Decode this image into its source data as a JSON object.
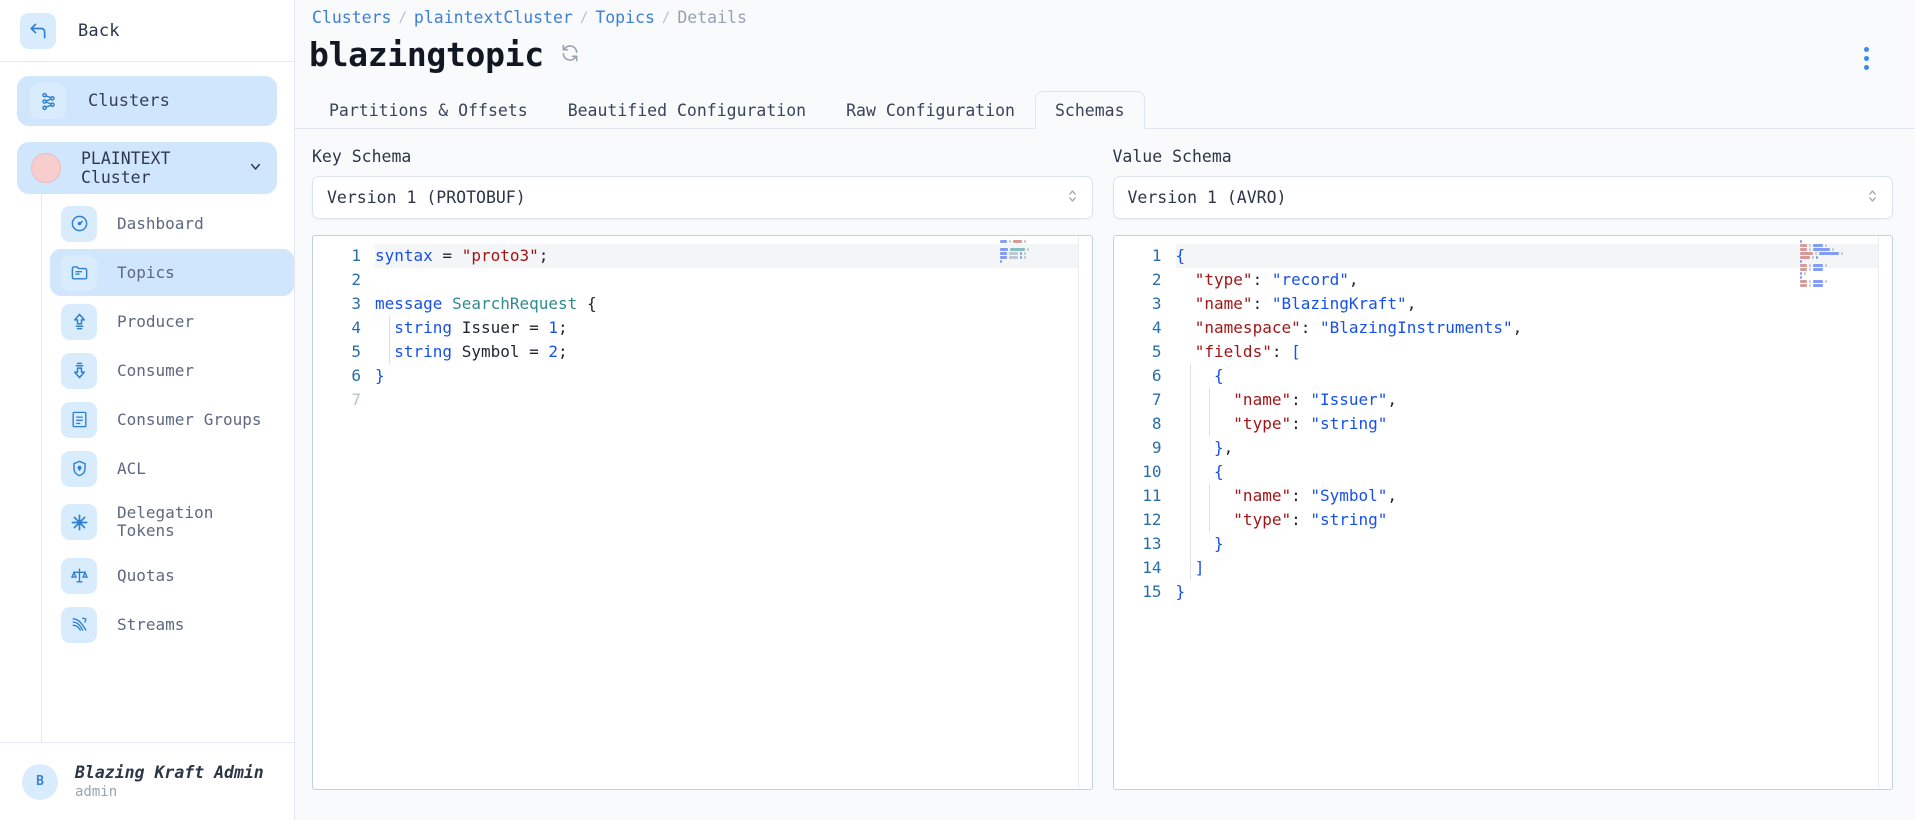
{
  "sidebar": {
    "back": {
      "label": "Back",
      "icon": "back-arrow-icon"
    },
    "clusters": {
      "label": "Clusters",
      "icon": "clusters-icon"
    },
    "cluster": {
      "label": "PLAINTEXT Cluster",
      "chevron": "∨"
    },
    "items": [
      {
        "label": "Dashboard",
        "icon": "gauge-icon",
        "active": false
      },
      {
        "label": "Topics",
        "icon": "folder-icon",
        "active": true
      },
      {
        "label": "Producer",
        "icon": "upload-icon",
        "active": false
      },
      {
        "label": "Consumer",
        "icon": "download-icon",
        "active": false
      },
      {
        "label": "Consumer Groups",
        "icon": "list-box-icon",
        "active": false
      },
      {
        "label": "ACL",
        "icon": "shield-icon",
        "active": false
      },
      {
        "label": "Delegation Tokens",
        "icon": "asterisk-icon",
        "active": false
      },
      {
        "label": "Quotas",
        "icon": "scales-icon",
        "active": false
      },
      {
        "label": "Streams",
        "icon": "streams-icon",
        "active": false
      }
    ],
    "user": {
      "initial": "B",
      "name": "Blazing Kraft Admin",
      "role": "admin"
    }
  },
  "header": {
    "breadcrumb": [
      {
        "label": "Clusters",
        "link": true
      },
      {
        "label": "plaintextCluster",
        "link": true
      },
      {
        "label": "Topics",
        "link": true
      },
      {
        "label": "Details",
        "link": false
      }
    ],
    "separator": "/",
    "title": "blazingtopic",
    "refresh_icon": "refresh-icon",
    "menu_icon": "kebab-menu-icon"
  },
  "tabs": [
    {
      "label": "Partitions & Offsets",
      "selected": false
    },
    {
      "label": "Beautified Configuration",
      "selected": false
    },
    {
      "label": "Raw Configuration",
      "selected": false
    },
    {
      "label": "Schemas",
      "selected": true
    }
  ],
  "key_schema": {
    "label": "Key Schema",
    "version": "Version 1 (PROTOBUF)",
    "line_numbers": [
      "1",
      "2",
      "3",
      "4",
      "5",
      "6",
      "7"
    ],
    "last_line_dim": true,
    "lines": [
      [
        {
          "t": "syntax",
          "c": "k"
        },
        {
          "t": " = ",
          "c": "pn"
        },
        {
          "t": "\"proto3\"",
          "c": "st"
        },
        {
          "t": ";",
          "c": "pn"
        }
      ],
      [],
      [
        {
          "t": "message",
          "c": "k"
        },
        {
          "t": " ",
          "c": "pn"
        },
        {
          "t": "SearchRequest",
          "c": "ty"
        },
        {
          "t": " {",
          "c": "pn"
        }
      ],
      [
        {
          "t": "  ",
          "c": "pn"
        },
        {
          "t": "string",
          "c": "k"
        },
        {
          "t": " Issuer = ",
          "c": "pn"
        },
        {
          "t": "1",
          "c": "nu"
        },
        {
          "t": ";",
          "c": "pn"
        }
      ],
      [
        {
          "t": "  ",
          "c": "pn"
        },
        {
          "t": "string",
          "c": "k"
        },
        {
          "t": " Symbol = ",
          "c": "pn"
        },
        {
          "t": "2",
          "c": "nu"
        },
        {
          "t": ";",
          "c": "pn"
        }
      ],
      [
        {
          "t": "}",
          "c": "k"
        }
      ],
      []
    ]
  },
  "value_schema": {
    "label": "Value Schema",
    "version": "Version 1 (AVRO)",
    "line_numbers": [
      "1",
      "2",
      "3",
      "4",
      "5",
      "6",
      "7",
      "8",
      "9",
      "10",
      "11",
      "12",
      "13",
      "14",
      "15"
    ],
    "last_line_dim": false,
    "lines": [
      [
        {
          "t": "{",
          "c": "br"
        }
      ],
      [
        {
          "t": "  ",
          "c": "pn"
        },
        {
          "t": "\"type\"",
          "c": "jk"
        },
        {
          "t": ": ",
          "c": "pn"
        },
        {
          "t": "\"record\"",
          "c": "jv"
        },
        {
          "t": ",",
          "c": "pn"
        }
      ],
      [
        {
          "t": "  ",
          "c": "pn"
        },
        {
          "t": "\"name\"",
          "c": "jk"
        },
        {
          "t": ": ",
          "c": "pn"
        },
        {
          "t": "\"BlazingKraft\"",
          "c": "jv"
        },
        {
          "t": ",",
          "c": "pn"
        }
      ],
      [
        {
          "t": "  ",
          "c": "pn"
        },
        {
          "t": "\"namespace\"",
          "c": "jk"
        },
        {
          "t": ": ",
          "c": "pn"
        },
        {
          "t": "\"BlazingInstruments\"",
          "c": "jv"
        },
        {
          "t": ",",
          "c": "pn"
        }
      ],
      [
        {
          "t": "  ",
          "c": "pn"
        },
        {
          "t": "\"fields\"",
          "c": "jk"
        },
        {
          "t": ": ",
          "c": "pn"
        },
        {
          "t": "[",
          "c": "br"
        }
      ],
      [
        {
          "t": "    ",
          "c": "pn"
        },
        {
          "t": "{",
          "c": "br"
        }
      ],
      [
        {
          "t": "      ",
          "c": "pn"
        },
        {
          "t": "\"name\"",
          "c": "jk"
        },
        {
          "t": ": ",
          "c": "pn"
        },
        {
          "t": "\"Issuer\"",
          "c": "jv"
        },
        {
          "t": ",",
          "c": "pn"
        }
      ],
      [
        {
          "t": "      ",
          "c": "pn"
        },
        {
          "t": "\"type\"",
          "c": "jk"
        },
        {
          "t": ": ",
          "c": "pn"
        },
        {
          "t": "\"string\"",
          "c": "jv"
        }
      ],
      [
        {
          "t": "    ",
          "c": "pn"
        },
        {
          "t": "}",
          "c": "br"
        },
        {
          "t": ",",
          "c": "pn"
        }
      ],
      [
        {
          "t": "    ",
          "c": "pn"
        },
        {
          "t": "{",
          "c": "br"
        }
      ],
      [
        {
          "t": "      ",
          "c": "pn"
        },
        {
          "t": "\"name\"",
          "c": "jk"
        },
        {
          "t": ": ",
          "c": "pn"
        },
        {
          "t": "\"Symbol\"",
          "c": "jv"
        },
        {
          "t": ",",
          "c": "pn"
        }
      ],
      [
        {
          "t": "      ",
          "c": "pn"
        },
        {
          "t": "\"type\"",
          "c": "jk"
        },
        {
          "t": ": ",
          "c": "pn"
        },
        {
          "t": "\"string\"",
          "c": "jv"
        }
      ],
      [
        {
          "t": "    ",
          "c": "pn"
        },
        {
          "t": "}",
          "c": "br"
        }
      ],
      [
        {
          "t": "  ",
          "c": "pn"
        },
        {
          "t": "]",
          "c": "br"
        }
      ],
      [
        {
          "t": "}",
          "c": "br"
        }
      ]
    ]
  },
  "colors": {
    "accent": "#3b8ae6",
    "active_nav_bg": "#cfe6fc",
    "icon_tile_bg": "#d9ecfd",
    "string_red": "#a31515",
    "keyword_blue": "#1750eb",
    "type_teal": "#2e8b92",
    "cluster_dot": "#f7cdcd"
  }
}
